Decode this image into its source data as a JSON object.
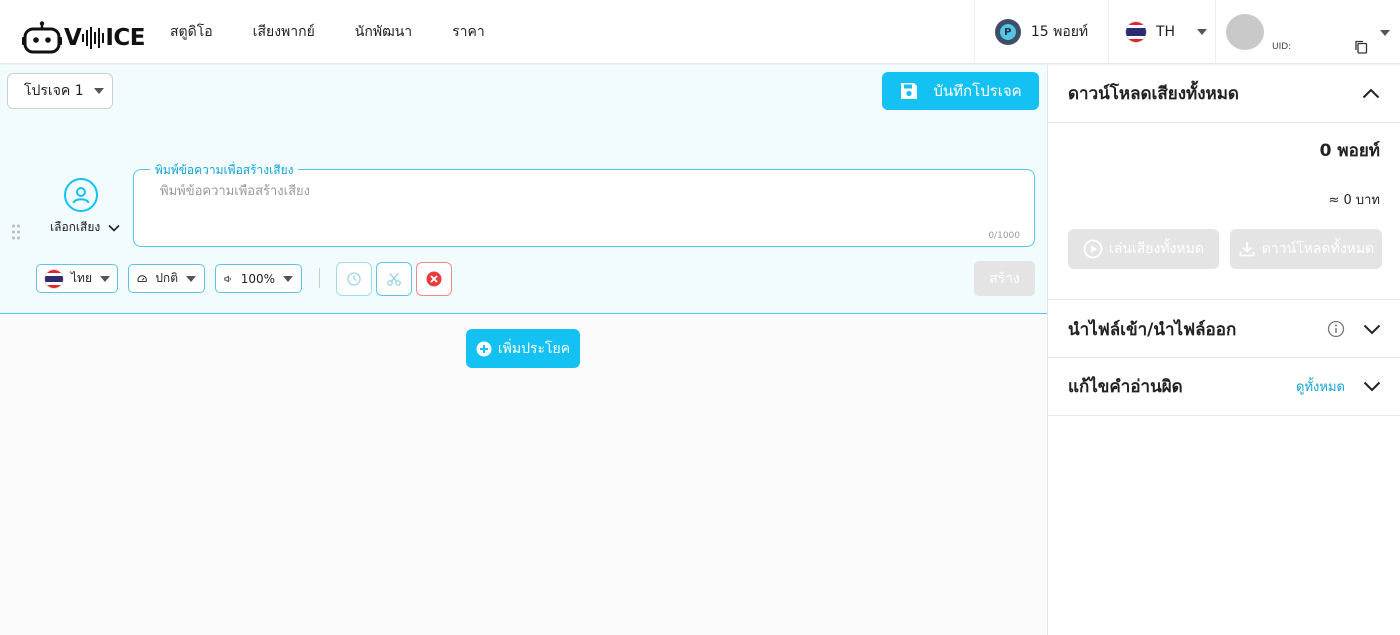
{
  "brand": {
    "logo_text_pre": "V",
    "logo_text_post": "ICE",
    "accent": "#13c2f2",
    "border_accent": "#58c7ea"
  },
  "nav": [
    {
      "label": "สตูดิโอ"
    },
    {
      "label": "เสียงพากย์"
    },
    {
      "label": "นักพัฒนา"
    },
    {
      "label": "ราคา"
    }
  ],
  "header": {
    "points_label": "15 พอยท์",
    "coin_letter": "P",
    "language": "TH",
    "uid_label": "UID:"
  },
  "editor": {
    "project_name": "โปรเจค 1",
    "save_label": "บันทึกโปรเจค",
    "voice_select_label": "เลือกเสียง",
    "text_legend": "พิมพ์ข้อความเพื่อสร้างเสียง",
    "text_placeholder": "พิมพ์ข้อความเพื่อสร้างเสียง",
    "text_value": "",
    "char_counter": "0/1000",
    "language_select": "ไทย",
    "speed_select": "ปกติ",
    "volume_select": "100%",
    "create_label": "สร้าง",
    "add_sentence_label": "เพิ่มประโยค"
  },
  "panel": {
    "title": "ดาวน์โหลดเสียงทั้งหมด",
    "total_points": "0 พอยท์",
    "total_baht": "≈ 0 บาท",
    "play_all_label": "เล่นเสียงทั้งหมด",
    "download_all_label": "ดาวน์โหลดทั้งหมด",
    "import_export_label": "นำไฟล์เข้า/นำไฟล์ออก",
    "mispronounce_label": "แก้ไขคำอ่านผิด",
    "see_all_label": "ดูทั้งหมด"
  },
  "icons": [
    "robot-logo-icon",
    "coin-icon",
    "thai-flag-icon",
    "copy-icon",
    "save-icon",
    "user-voice-icon",
    "drag-handle-icon",
    "speedometer-icon",
    "speaker-icon",
    "clock-icon",
    "scissors-icon",
    "close-circle-icon",
    "plus-circle-icon",
    "play-circle-icon",
    "download-icon",
    "info-icon"
  ]
}
